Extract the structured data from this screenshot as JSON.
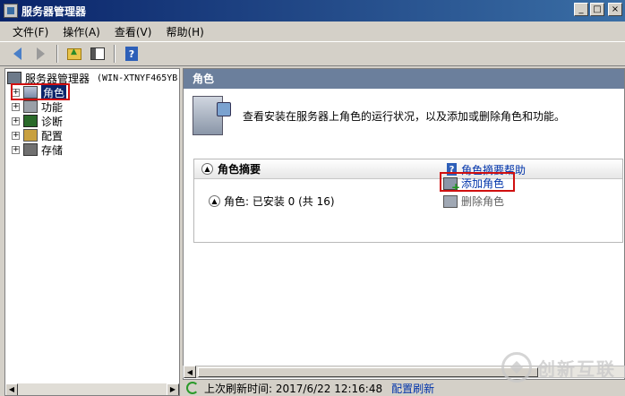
{
  "window": {
    "title": "服务器管理器",
    "controls": [
      "_",
      "□",
      "×"
    ]
  },
  "menu": [
    "文件(F)",
    "操作(A)",
    "查看(V)",
    "帮助(H)"
  ],
  "toolbar": {
    "icons": [
      "back-arrow-icon",
      "forward-arrow-icon",
      "up-folder-icon",
      "show-hide-pane-icon",
      "help-icon"
    ],
    "help_glyph": "?"
  },
  "tree": {
    "root_label": "服务器管理器",
    "root_host": "(WIN-XTNYF465YB",
    "items": [
      {
        "label": "角色",
        "selected": true
      },
      {
        "label": "功能"
      },
      {
        "label": "诊断"
      },
      {
        "label": "配置"
      },
      {
        "label": "存储"
      }
    ],
    "expander_glyph": "+"
  },
  "main": {
    "header": "角色",
    "description": "查看安装在服务器上角色的运行状况，以及添加或删除角色和功能。",
    "section_title": "角色摘要",
    "section_help_link": "角色摘要帮助",
    "roles_status": "角色: 已安装 0 (共 16)",
    "actions": {
      "add_role": "添加角色",
      "remove_role": "删除角色"
    }
  },
  "status": {
    "last_refresh": "上次刷新时间: 2017/6/22 12:16:48",
    "configure_refresh": "配置刷新"
  },
  "watermark": {
    "text": "创新互联"
  },
  "colors": {
    "title_bar": "#0a246a",
    "pane_header": "#6b7f9c",
    "link": "#0033aa",
    "highlight_box": "#d01010"
  }
}
